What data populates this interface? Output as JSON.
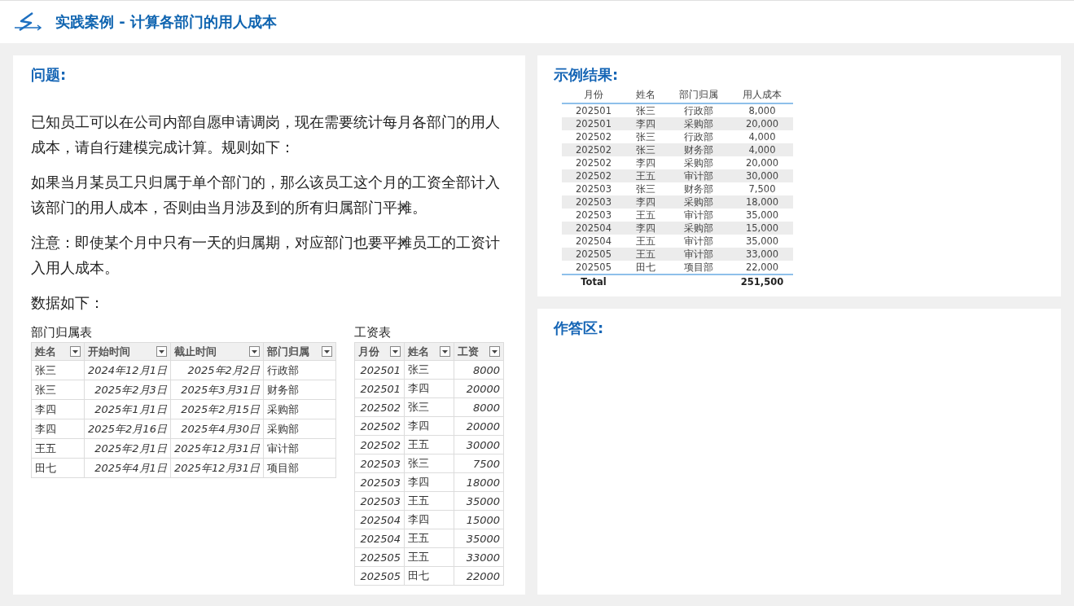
{
  "header": {
    "title": "实践案例 - 计算各部门的用人成本"
  },
  "problem": {
    "heading": "问题:",
    "paragraphs": [
      "已知员工可以在公司内部自愿申请调岗，现在需要统计每月各部门的用人成本，请自行建模完成计算。规则如下：",
      "如果当月某员工只归属于单个部门的，那么该员工这个月的工资全部计入该部门的用人成本，否则由当月涉及到的所有归属部门平摊。",
      "注意：即使某个月中只有一天的归属期，对应部门也要平摊员工的工资计入用人成本。",
      "数据如下："
    ]
  },
  "dept_table": {
    "title": "部门归属表",
    "columns": [
      "姓名",
      "开始时间",
      "截止时间",
      "部门归属"
    ],
    "rows": [
      [
        "张三",
        "2024年12月1日",
        "2025年2月2日",
        "行政部"
      ],
      [
        "张三",
        "2025年2月3日",
        "2025年3月31日",
        "财务部"
      ],
      [
        "李四",
        "2025年1月1日",
        "2025年2月15日",
        "采购部"
      ],
      [
        "李四",
        "2025年2月16日",
        "2025年4月30日",
        "采购部"
      ],
      [
        "王五",
        "2025年2月1日",
        "2025年12月31日",
        "审计部"
      ],
      [
        "田七",
        "2025年4月1日",
        "2025年12月31日",
        "项目部"
      ]
    ]
  },
  "salary_table": {
    "title": "工资表",
    "columns": [
      "月份",
      "姓名",
      "工资"
    ],
    "rows": [
      [
        "202501",
        "张三",
        "8000"
      ],
      [
        "202501",
        "李四",
        "20000"
      ],
      [
        "202502",
        "张三",
        "8000"
      ],
      [
        "202502",
        "李四",
        "20000"
      ],
      [
        "202502",
        "王五",
        "30000"
      ],
      [
        "202503",
        "张三",
        "7500"
      ],
      [
        "202503",
        "李四",
        "18000"
      ],
      [
        "202503",
        "王五",
        "35000"
      ],
      [
        "202504",
        "李四",
        "15000"
      ],
      [
        "202504",
        "王五",
        "35000"
      ],
      [
        "202505",
        "王五",
        "33000"
      ],
      [
        "202505",
        "田七",
        "22000"
      ]
    ]
  },
  "result": {
    "heading": "示例结果:",
    "columns": [
      "月份",
      "姓名",
      "部门归属",
      "用人成本"
    ],
    "rows": [
      [
        "202501",
        "张三",
        "行政部",
        "8,000"
      ],
      [
        "202501",
        "李四",
        "采购部",
        "20,000"
      ],
      [
        "202502",
        "张三",
        "行政部",
        "4,000"
      ],
      [
        "202502",
        "张三",
        "财务部",
        "4,000"
      ],
      [
        "202502",
        "李四",
        "采购部",
        "20,000"
      ],
      [
        "202502",
        "王五",
        "审计部",
        "30,000"
      ],
      [
        "202503",
        "张三",
        "财务部",
        "7,500"
      ],
      [
        "202503",
        "李四",
        "采购部",
        "18,000"
      ],
      [
        "202503",
        "王五",
        "审计部",
        "35,000"
      ],
      [
        "202504",
        "李四",
        "采购部",
        "15,000"
      ],
      [
        "202504",
        "王五",
        "审计部",
        "35,000"
      ],
      [
        "202505",
        "王五",
        "审计部",
        "33,000"
      ],
      [
        "202505",
        "田七",
        "项目部",
        "22,000"
      ]
    ],
    "total": {
      "label": "Total",
      "value": "251,500"
    }
  },
  "answer": {
    "heading": "作答区:"
  }
}
